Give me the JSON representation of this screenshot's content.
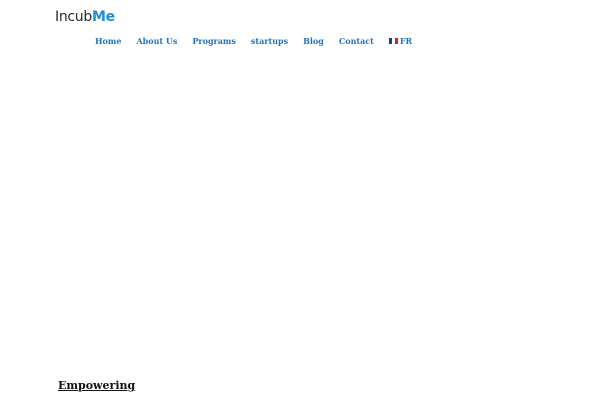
{
  "header": {
    "logo": {
      "part1": "Incub",
      "part2": "Me"
    },
    "nav": {
      "home": "Home",
      "about": "About Us",
      "programs": "Programs",
      "startups": "startups",
      "blog": "Blog",
      "contact": "Contact",
      "language": "FR"
    }
  },
  "main": {
    "headline": "Empowering"
  },
  "colors": {
    "link": "#1d74c3",
    "logo_accent": "#1d8fd6"
  },
  "icons": {
    "language": "french-flag-icon"
  }
}
